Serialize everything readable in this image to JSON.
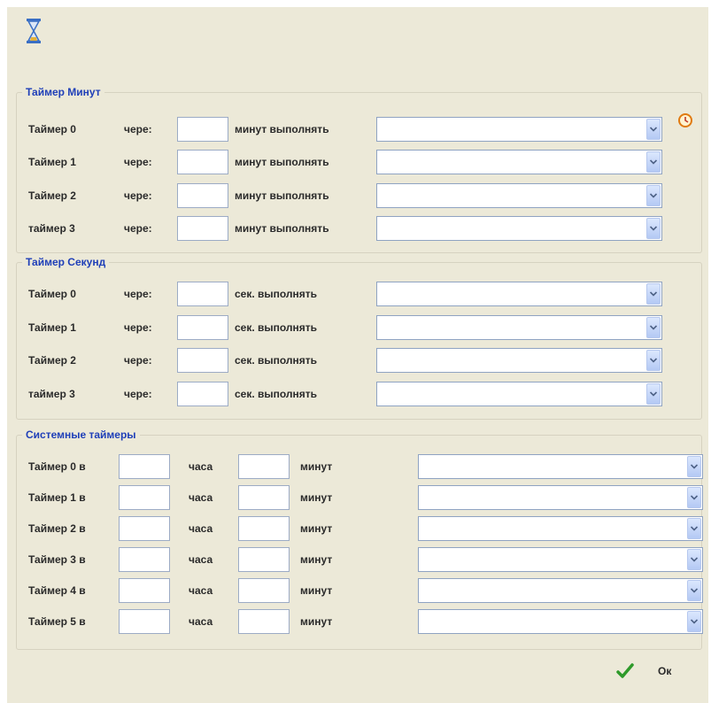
{
  "minute_timers": {
    "title": "Таймер Минут",
    "rows": [
      {
        "name": "Таймер 0",
        "via": "чере:",
        "value": "",
        "action": "минут выполнять",
        "selected": ""
      },
      {
        "name": "Таймер 1",
        "via": "чере:",
        "value": "",
        "action": "минут выполнять",
        "selected": ""
      },
      {
        "name": "Таймер 2",
        "via": "чере:",
        "value": "",
        "action": "минут выполнять",
        "selected": ""
      },
      {
        "name": "таймер 3",
        "via": "чере:",
        "value": "",
        "action": "минут выполнять",
        "selected": ""
      }
    ]
  },
  "second_timers": {
    "title": "Таймер Секунд",
    "rows": [
      {
        "name": "Таймер 0",
        "via": "чере:",
        "value": "",
        "action": "сек. выполнять",
        "selected": ""
      },
      {
        "name": "Таймер 1",
        "via": "чере:",
        "value": "",
        "action": "сек. выполнять",
        "selected": ""
      },
      {
        "name": "Таймер 2",
        "via": "чере:",
        "value": "",
        "action": "сек. выполнять",
        "selected": ""
      },
      {
        "name": "таймер 3",
        "via": "чере:",
        "value": "",
        "action": "сек. выполнять",
        "selected": ""
      }
    ]
  },
  "system_timers": {
    "title": "Системные таймеры",
    "rows": [
      {
        "name": "Таймер 0 в",
        "hours_label": "часа",
        "hours": "",
        "minutes_label": "минут",
        "minutes": "",
        "selected": ""
      },
      {
        "name": "Таймер 1 в",
        "hours_label": "часа",
        "hours": "",
        "minutes_label": "минут",
        "minutes": "",
        "selected": ""
      },
      {
        "name": "Таймер 2 в",
        "hours_label": "часа",
        "hours": "",
        "minutes_label": "минут",
        "minutes": "",
        "selected": ""
      },
      {
        "name": "Таймер 3 в",
        "hours_label": "часа",
        "hours": "",
        "minutes_label": "минут",
        "minutes": "",
        "selected": ""
      },
      {
        "name": "Таймер 4 в",
        "hours_label": "часа",
        "hours": "",
        "minutes_label": "минут",
        "minutes": "",
        "selected": ""
      },
      {
        "name": "Таймер 5 в",
        "hours_label": "часа",
        "hours": "",
        "minutes_label": "минут",
        "minutes": "",
        "selected": ""
      }
    ]
  },
  "footer": {
    "ok_label": "Ок"
  },
  "icons": {
    "window": "hourglass-icon",
    "apply_timer": "clock-icon",
    "ok": "checkmark-icon"
  },
  "colors": {
    "background": "#ece9d8",
    "group_title": "#1f3fb8",
    "field_border": "#9cabc5",
    "combo_button": "#c3d3f7"
  }
}
